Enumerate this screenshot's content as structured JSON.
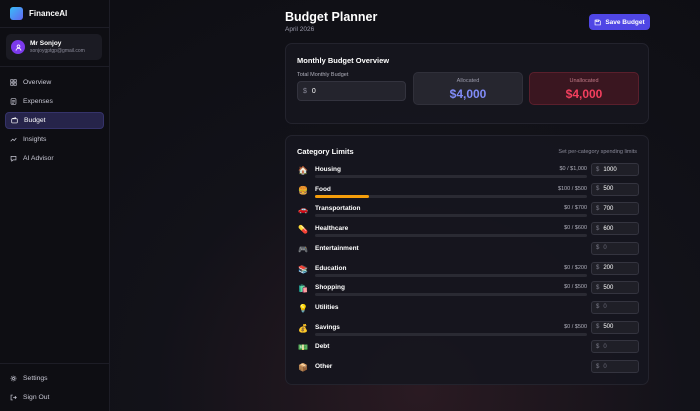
{
  "brand": {
    "name": "FinanceAI"
  },
  "user": {
    "name": "Mr Sonjoy",
    "email": "sonjoygptgp@gmail.com"
  },
  "nav": [
    {
      "label": "Overview",
      "icon": "grid-icon"
    },
    {
      "label": "Expenses",
      "icon": "list-icon"
    },
    {
      "label": "Budget",
      "icon": "wallet-icon",
      "active": true
    },
    {
      "label": "Insights",
      "icon": "trend-icon"
    },
    {
      "label": "AI Advisor",
      "icon": "chat-icon"
    }
  ],
  "nav_bottom": [
    {
      "label": "Settings",
      "icon": "gear-icon"
    },
    {
      "label": "Sign Out",
      "icon": "logout-icon"
    }
  ],
  "header": {
    "title": "Budget Planner",
    "subtitle": "April 2026",
    "save_label": "Save Budget"
  },
  "overview": {
    "title": "Monthly Budget Overview",
    "total_label": "Total Monthly Budget",
    "currency": "$",
    "total_value": "0",
    "allocated_label": "Allocated",
    "allocated_value": "$4,000",
    "unallocated_label": "Unallocated",
    "unallocated_value": "$4,000"
  },
  "categories_card": {
    "title": "Category Limits",
    "hint": "Set per-category spending limits"
  },
  "categories": [
    {
      "icon": "🏠",
      "name": "Housing",
      "amount": "$0 / $1,000",
      "input": "1000",
      "progress": 0
    },
    {
      "icon": "🍔",
      "name": "Food",
      "amount": "$100 / $500",
      "input": "500",
      "progress": 0.2
    },
    {
      "icon": "🚗",
      "name": "Transportation",
      "amount": "$0 / $700",
      "input": "700",
      "progress": 0
    },
    {
      "icon": "💊",
      "name": "Healthcare",
      "amount": "$0 / $600",
      "input": "600",
      "progress": 0
    },
    {
      "icon": "🎮",
      "name": "Entertainment",
      "amount": "",
      "input": "0",
      "progress": null
    },
    {
      "icon": "📚",
      "name": "Education",
      "amount": "$0 / $200",
      "input": "200",
      "progress": 0
    },
    {
      "icon": "🛍️",
      "name": "Shopping",
      "amount": "$0 / $500",
      "input": "500",
      "progress": 0
    },
    {
      "icon": "💡",
      "name": "Utilities",
      "amount": "",
      "input": "0",
      "progress": null
    },
    {
      "icon": "💰",
      "name": "Savings",
      "amount": "$0 / $500",
      "input": "500",
      "progress": 0
    },
    {
      "icon": "💵",
      "name": "Debt",
      "amount": "",
      "input": "0",
      "progress": null
    },
    {
      "icon": "📦",
      "name": "Other",
      "amount": "",
      "input": "0",
      "progress": null
    }
  ],
  "colors": {
    "accent": "#4f46e5",
    "allocated": "#818cf8",
    "unallocated": "#f43f5e",
    "progress": "#f59e0b"
  }
}
